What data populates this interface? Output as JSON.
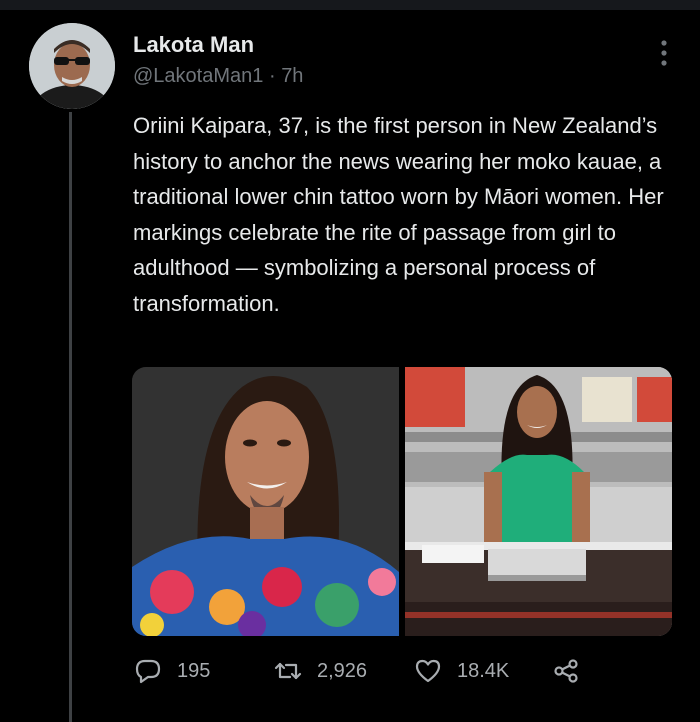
{
  "tweet": {
    "author_name": "Lakota Man",
    "handle": "@LakotaMan1",
    "separator": "·",
    "time_ago": "7h",
    "text": "Oriini Kaipara, 37, is the first person in New Zealand’s history to anchor the news wearing her moko kauae, a traditional lower chin tattoo worn by Māori women. Her markings celebrate the rite of passage from girl to adulthood — symbolizing a personal process of transformation.",
    "media": {
      "count": 2
    }
  },
  "actions": {
    "reply": {
      "icon": "reply-icon",
      "count": "195"
    },
    "retweet": {
      "icon": "retweet-icon",
      "count": "2,926"
    },
    "like": {
      "icon": "heart-icon",
      "count": "18.4K"
    },
    "share": {
      "icon": "share-icon"
    }
  },
  "colors": {
    "background": "#000000",
    "text_primary": "#e7e9ea",
    "text_secondary": "#71767b",
    "thread_line": "#3e4144"
  }
}
